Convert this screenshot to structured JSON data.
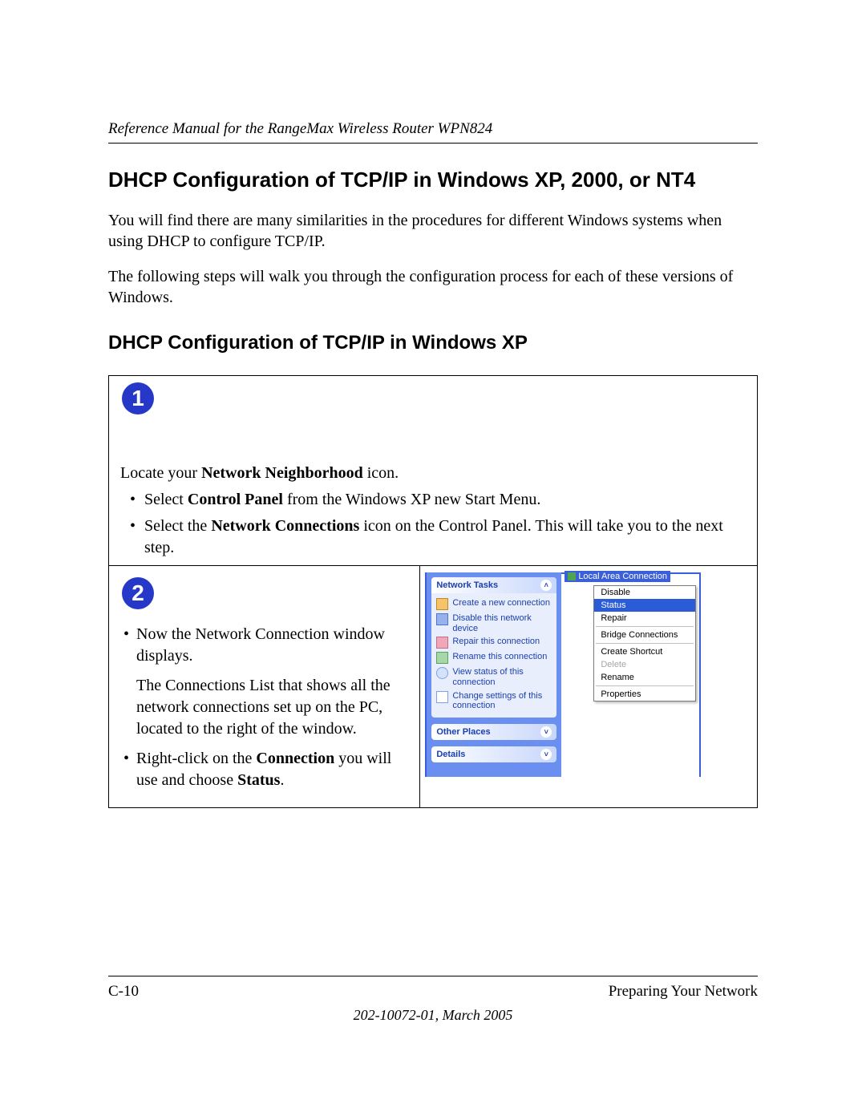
{
  "header": "Reference Manual for the RangeMax Wireless Router WPN824",
  "h1": "DHCP Configuration of TCP/IP in Windows XP, 2000, or NT4",
  "p1": "You will find there are many similarities in the procedures for different Windows systems when using DHCP to configure TCP/IP.",
  "p2": "The following steps will walk you through the configuration process for each of these versions of Windows.",
  "h2": "DHCP Configuration of TCP/IP in Windows XP",
  "step1": {
    "num": "1",
    "lead_a": "Locate your ",
    "lead_b": "Network Neighborhood",
    "lead_c": " icon.",
    "b1_a": "Select ",
    "b1_b": "Control Panel",
    "b1_c": " from the Windows XP new Start Menu.",
    "b2_a": "Select the ",
    "b2_b": "Network Connections",
    "b2_c": " icon on the Control Panel.  This will take you to the next step."
  },
  "step2": {
    "num": "2",
    "b1": "Now the Network Connection window displays.",
    "p1": "The Connections List that shows all the network connections set up on the PC, located to the right of the window.",
    "b2_a": "Right-click on the ",
    "b2_b": "Connection",
    "b2_c": " you will use and choose ",
    "b2_d": "Status",
    "b2_e": "."
  },
  "xp": {
    "tasks_title": "Network Tasks",
    "links": {
      "new": "Create a new connection",
      "dis": "Disable this network device",
      "rep": "Repair this connection",
      "ren": "Rename this connection",
      "view": "View status of this connection",
      "set": "Change settings of this connection"
    },
    "other": "Other Places",
    "details": "Details",
    "conn_label": "Local Area Connection",
    "menu": {
      "disable": "Disable",
      "status": "Status",
      "repair": "Repair",
      "bridge": "Bridge Connections",
      "shortcut": "Create Shortcut",
      "delete": "Delete",
      "rename": "Rename",
      "props": "Properties"
    }
  },
  "footer": {
    "left": "C-10",
    "right": "Preparing Your Network",
    "sub": "202-10072-01, March 2005"
  }
}
